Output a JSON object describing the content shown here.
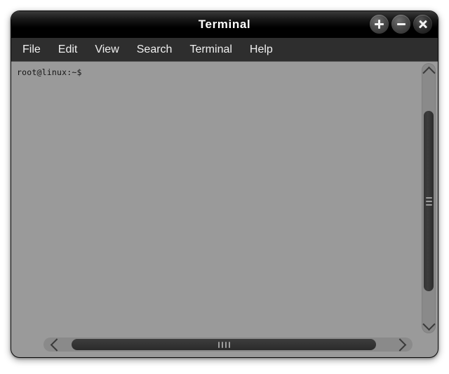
{
  "window": {
    "title": "Terminal",
    "controls": [
      {
        "name": "maximize",
        "glyph": "+"
      },
      {
        "name": "minimize",
        "glyph": "−"
      },
      {
        "name": "close",
        "glyph": "×"
      }
    ]
  },
  "menubar": {
    "items": [
      {
        "label": "File"
      },
      {
        "label": "Edit"
      },
      {
        "label": "View"
      },
      {
        "label": "Search"
      },
      {
        "label": "Terminal"
      },
      {
        "label": "Help"
      }
    ]
  },
  "terminal": {
    "background_color": "#9a9a9a",
    "text_color": "#141414",
    "lines": [
      "root@linux:~$"
    ],
    "prompt": "root@linux:~$"
  },
  "scrollbars": {
    "vertical": {
      "up_arrow_icon": "chevron-up-icon",
      "down_arrow_icon": "chevron-down-icon",
      "grip_lines": 3
    },
    "horizontal": {
      "left_arrow_icon": "chevron-left-icon",
      "right_arrow_icon": "chevron-right-icon",
      "grip_lines": 4
    }
  },
  "colors": {
    "titlebar": "#000000",
    "menubar": "#2e2e2e",
    "terminal_bg": "#9a9a9a",
    "thumb": "#333333",
    "page_bg": "#ffffff"
  }
}
